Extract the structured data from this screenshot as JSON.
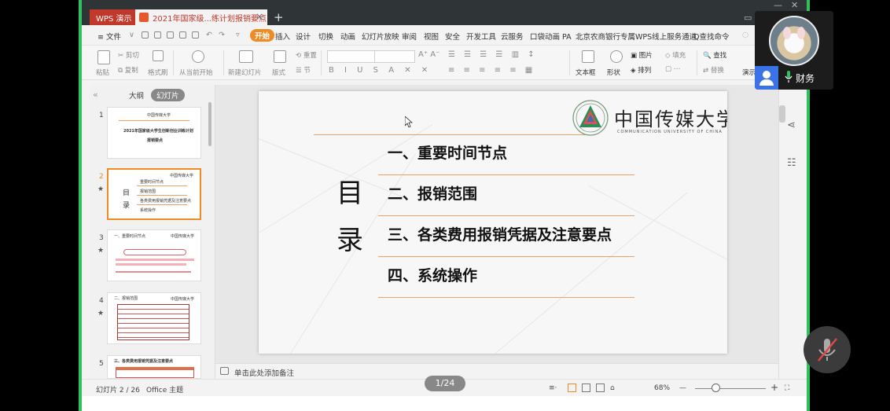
{
  "window": {
    "app_tab": "WPS 演示",
    "doc_tab": "2021年国家级...练计划报销要点"
  },
  "menu": {
    "file": "≡ 文件",
    "items": [
      "开始",
      "插入",
      "设计",
      "切换",
      "动画",
      "幻灯片放映",
      "审阅",
      "视图",
      "安全",
      "开发工具",
      "云服务",
      "口袋动画 PA",
      "北京农商银行专属WPS线上服务通道"
    ],
    "search": "Q查找命令"
  },
  "ribbon": {
    "paste": "粘贴",
    "cut": "剪切",
    "copy": "复制",
    "format_painter": "格式刷",
    "from_start": "从当前开始",
    "new_slide": "新建幻灯片",
    "layout": "版式",
    "reset": "重置",
    "section": "节",
    "textbox": "文本框",
    "shape": "形状",
    "picture": "图片",
    "arrange": "排列",
    "fill": "填充",
    "find": "查找",
    "replace": "替换",
    "present": "演示"
  },
  "left_panel": {
    "tab_outline": "大纲",
    "tab_slides": "幻灯片",
    "thumbs": [
      {
        "num": "1",
        "title": "2021年国家级大学生创新创业训练计划",
        "subtitle": "报销要点"
      },
      {
        "num": "2",
        "items": [
          "重要时间节点",
          "报销范围",
          "各类费用报销凭据及注意要点",
          "系统操作"
        ]
      },
      {
        "num": "3",
        "title": "一、重要时间节点"
      },
      {
        "num": "4",
        "title": "二、报销范围"
      },
      {
        "num": "5",
        "title": "三、各类费用报销凭据及注意要点"
      }
    ]
  },
  "slide": {
    "logo_text": "中国传媒大学",
    "logo_sub": "COMMUNICATION UNIVERSITY OF CHINA",
    "title_chars": [
      "目",
      "录"
    ],
    "items": [
      "一、重要时间节点",
      "二、报销范围",
      "三、各类费用报销凭据及注意要点",
      "四、系统操作"
    ]
  },
  "notes": {
    "placeholder": "单击此处添加备注"
  },
  "status": {
    "slide_pos": "幻灯片 2 / 26",
    "theme": "Office 主题",
    "page_pill": "1/24",
    "zoom": "68%"
  },
  "participant": {
    "name": "财务"
  }
}
